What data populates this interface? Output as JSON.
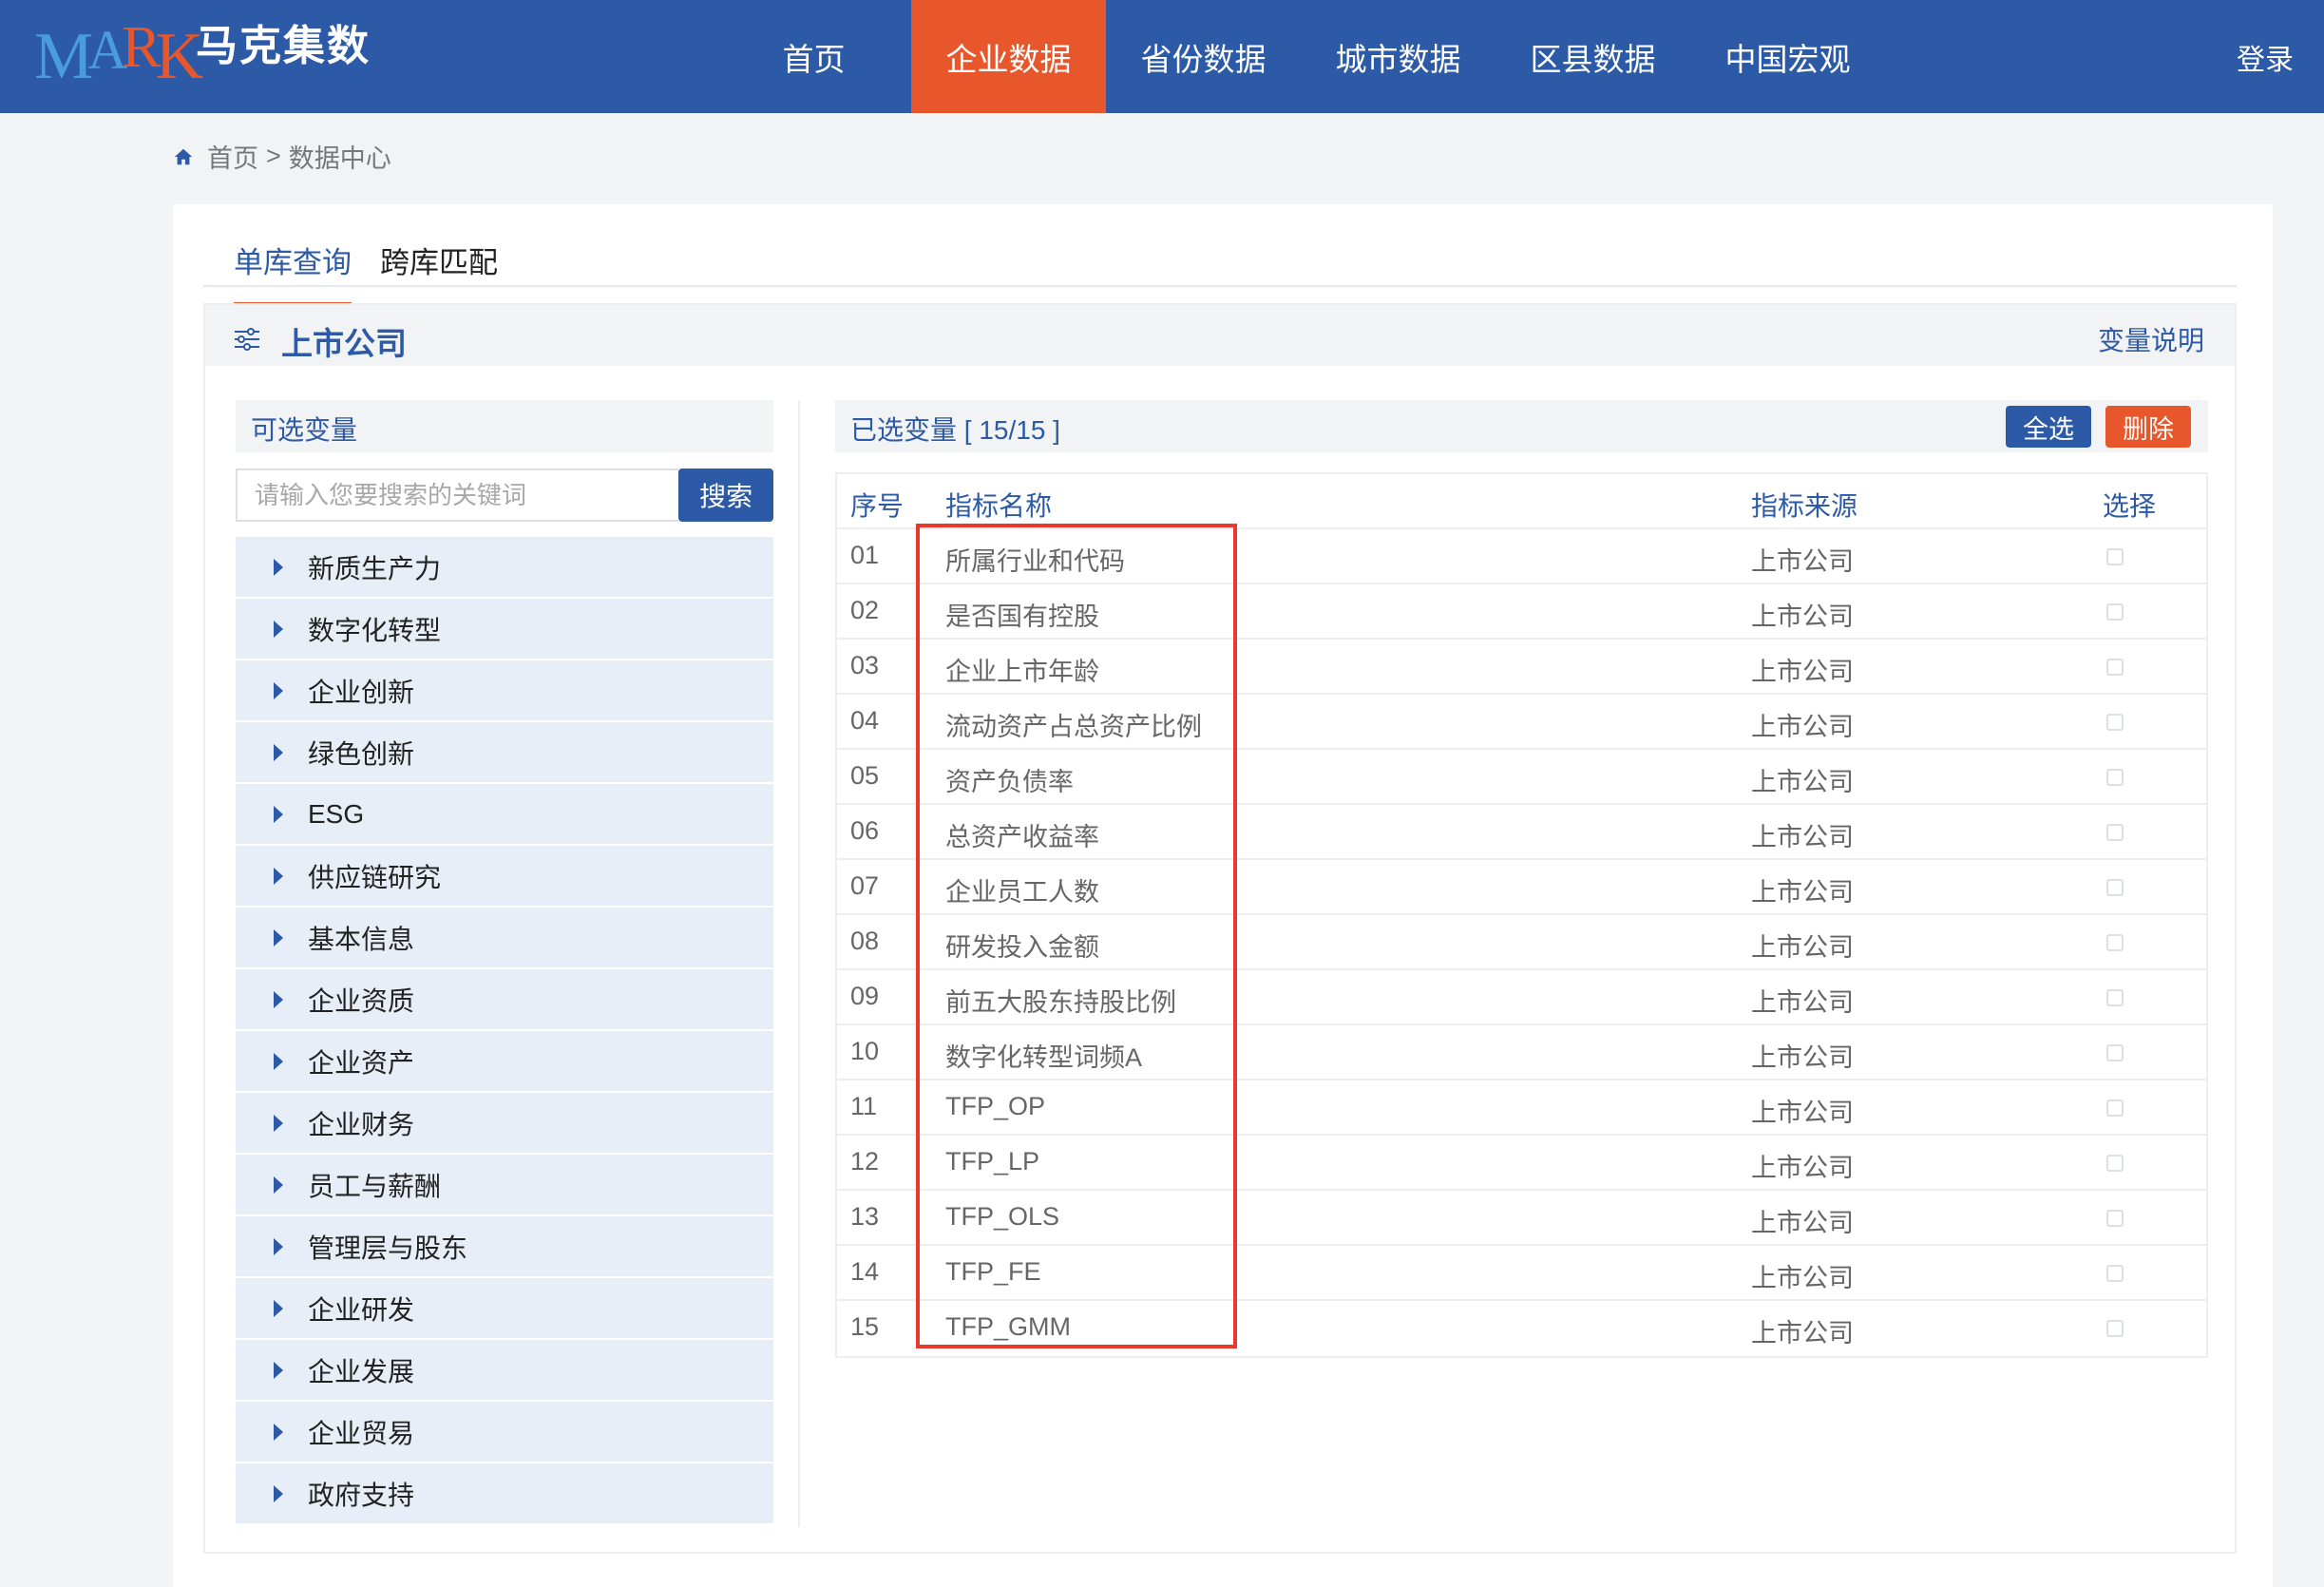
{
  "header": {
    "logo": "MARK",
    "site_name": "马克集数",
    "nav": [
      {
        "label": "首页",
        "active": false
      },
      {
        "label": "企业数据",
        "active": true
      },
      {
        "label": "省份数据",
        "active": false
      },
      {
        "label": "城市数据",
        "active": false
      },
      {
        "label": "区县数据",
        "active": false
      },
      {
        "label": "中国宏观",
        "active": false
      }
    ],
    "login": "登录"
  },
  "breadcrumb": {
    "home": "首页",
    "separator": ">",
    "current": "数据中心"
  },
  "tabs": [
    {
      "label": "单库查询",
      "active": true
    },
    {
      "label": "跨库匹配",
      "active": false
    }
  ],
  "panel": {
    "title": "上市公司",
    "variable_description_link": "变量说明"
  },
  "left": {
    "header": "可选变量",
    "search_placeholder": "请输入您要搜索的关键词",
    "search_button": "搜索",
    "categories": [
      "新质生产力",
      "数字化转型",
      "企业创新",
      "绿色创新",
      "ESG",
      "供应链研究",
      "基本信息",
      "企业资质",
      "企业资产",
      "企业财务",
      "员工与薪酬",
      "管理层与股东",
      "企业研发",
      "企业发展",
      "企业贸易",
      "政府支持"
    ]
  },
  "right": {
    "selected_label": "已选变量 [ 15/15 ]",
    "select_all_button": "全选",
    "delete_button": "删除",
    "columns": {
      "no": "序号",
      "name": "指标名称",
      "source": "指标来源",
      "select": "选择"
    },
    "rows": [
      {
        "no": "01",
        "name": "所属行业和代码",
        "source": "上市公司"
      },
      {
        "no": "02",
        "name": "是否国有控股",
        "source": "上市公司"
      },
      {
        "no": "03",
        "name": "企业上市年龄",
        "source": "上市公司"
      },
      {
        "no": "04",
        "name": "流动资产占总资产比例",
        "source": "上市公司"
      },
      {
        "no": "05",
        "name": "资产负债率",
        "source": "上市公司"
      },
      {
        "no": "06",
        "name": "总资产收益率",
        "source": "上市公司"
      },
      {
        "no": "07",
        "name": "企业员工人数",
        "source": "上市公司"
      },
      {
        "no": "08",
        "name": "研发投入金额",
        "source": "上市公司"
      },
      {
        "no": "09",
        "name": "前五大股东持股比例",
        "source": "上市公司"
      },
      {
        "no": "10",
        "name": "数字化转型词频A",
        "source": "上市公司"
      },
      {
        "no": "11",
        "name": "TFP_OP",
        "source": "上市公司"
      },
      {
        "no": "12",
        "name": "TFP_LP",
        "source": "上市公司"
      },
      {
        "no": "13",
        "name": "TFP_OLS",
        "source": "上市公司"
      },
      {
        "no": "14",
        "name": "TFP_FE",
        "source": "上市公司"
      },
      {
        "no": "15",
        "name": "TFP_GMM",
        "source": "上市公司"
      }
    ]
  },
  "colors": {
    "primary": "#2d5aa6",
    "accent": "#e8572b",
    "highlight": "#e8392b"
  }
}
